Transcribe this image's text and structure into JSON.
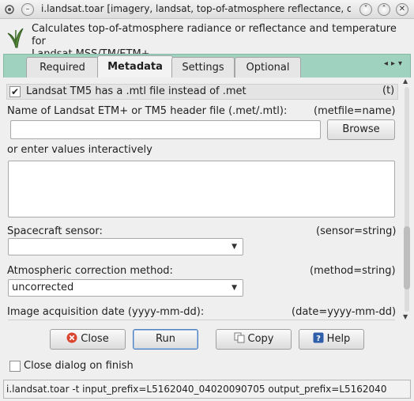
{
  "window": {
    "title": "i.landsat.toar [imagery, landsat, top-of-atmosphere reflectance, do…"
  },
  "header": {
    "description_line1": "Calculates top-of-atmosphere radiance or reflectance and temperature for",
    "description_line2": "Landsat MSS/TM/ETM+."
  },
  "tabs": [
    {
      "label": "Required",
      "active": false
    },
    {
      "label": "Metadata",
      "active": true
    },
    {
      "label": "Settings",
      "active": false
    },
    {
      "label": "Optional",
      "active": false
    }
  ],
  "metadata": {
    "mtl_checkbox": {
      "label": "Landsat TM5 has a .mtl file instead of .met",
      "flag": "(t)",
      "checked": true
    },
    "metfile": {
      "label": "Name of Landsat ETM+ or TM5 header file (.met/.mtl):",
      "param": "(metfile=name)",
      "value": "",
      "browse_label": "Browse"
    },
    "interactive_label": "or enter values interactively",
    "sensor": {
      "label": "Spacecraft sensor:",
      "param": "(sensor=string)",
      "value": ""
    },
    "method": {
      "label": "Atmospheric correction method:",
      "param": "(method=string)",
      "value": "uncorrected"
    },
    "date": {
      "label": "Image acquisition date (yyyy-mm-dd):",
      "param": "(date=yyyy-mm-dd)"
    }
  },
  "buttons": {
    "close": "Close",
    "run": "Run",
    "copy": "Copy",
    "help": "Help"
  },
  "close_on_finish": {
    "label": "Close dialog on finish",
    "checked": false
  },
  "command_line": "i.landsat.toar -t input_prefix=L5162040_04020090705 output_prefix=L5162040",
  "colors": {
    "tab_strip": "#9fd3c0",
    "close_icon": "#d9452f",
    "help_icon": "#2f5fa8"
  }
}
